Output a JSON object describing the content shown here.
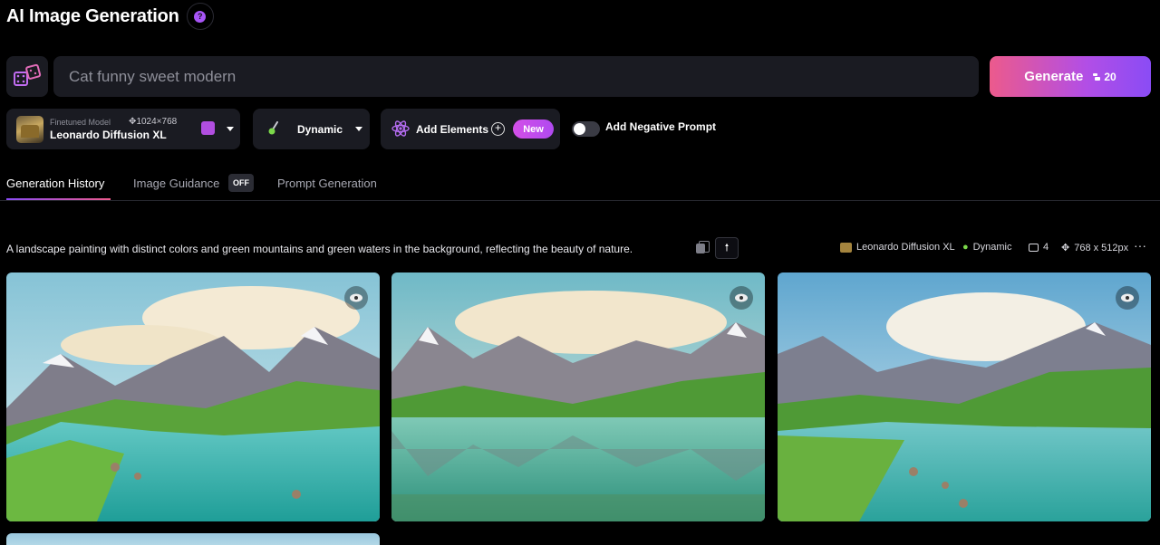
{
  "header": {
    "title": "AI Image Generation",
    "help_icon_label": "?"
  },
  "prompt": {
    "value": "Cat funny sweet modern"
  },
  "generate": {
    "label": "Generate",
    "cost": "20"
  },
  "model": {
    "kicker": "Finetuned Model",
    "resolution": "1024×768",
    "name": "Leonardo Diffusion XL"
  },
  "style": {
    "label": "Dynamic"
  },
  "elements": {
    "label": "Add Elements",
    "badge": "New"
  },
  "negative_prompt": {
    "label": "Add Negative Prompt",
    "enabled": false
  },
  "tabs": [
    {
      "label": "Generation History",
      "active": true
    },
    {
      "label": "Image Guidance",
      "badge": "OFF"
    },
    {
      "label": "Prompt Generation"
    }
  ],
  "generation": {
    "prompt": "A landscape painting with distinct colors and green mountains and green waters in the background, reflecting the beauty of nature.",
    "model": "Leonardo Diffusion XL",
    "style": "Dynamic",
    "count": "4",
    "size": "768 x 512px",
    "more": "···"
  },
  "colors": {
    "accent_start": "#ec5a8c",
    "accent_end": "#8a4cf5",
    "surface": "#1a1b22"
  },
  "icons": [
    "dice-icon",
    "help-icon",
    "coin-icon",
    "model-thumbnail",
    "brush-icon",
    "atom-icon",
    "plus-circle-icon",
    "copy-icon",
    "arrow-up-icon",
    "eye-icon",
    "resize-icon",
    "images-icon",
    "more-icon"
  ]
}
